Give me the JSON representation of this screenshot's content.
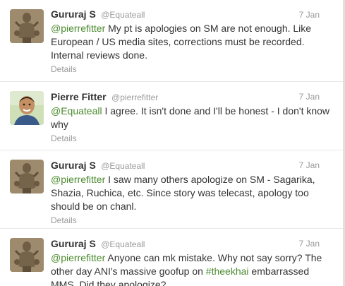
{
  "tweets": [
    {
      "fullname": "Gururaj S",
      "username": "@Equateall",
      "time": "7 Jan",
      "mention": "@pierrefitter",
      "text": " My pt is apologies on SM are not enough. Like European / US media sites, corrections must be recorded. Internal reviews done.",
      "details": "Details"
    },
    {
      "fullname": "Pierre Fitter",
      "username": "@pierrefitter",
      "time": "7 Jan",
      "mention": "@Equateall",
      "text": " I agree. It isn't done and I'll be honest - I don't know why",
      "details": "Details"
    },
    {
      "fullname": "Gururaj S",
      "username": "@Equateall",
      "time": "7 Jan",
      "mention": "@pierrefitter",
      "text": " I saw many others apologize on SM - Sagarika, Shazia, Ruchica, etc. Since story was telecast, apology too should be on chanl.",
      "details": "Details"
    },
    {
      "fullname": "Gururaj S",
      "username": "@Equateall",
      "time": "7 Jan",
      "mention": "@pierrefitter",
      "text": " Anyone can mk mistake. Why not say sorry? The other day ANI's massive goofup on ",
      "hashtag": "#theekhai",
      "text_after": " embarrassed MMS. Did they apologize?"
    }
  ],
  "colors": {
    "link": "#4a8a2e",
    "muted": "#999999",
    "text": "#333333",
    "divider": "#e8e8e8"
  },
  "icons": {
    "statue_avatar": "carved-statue-avatar",
    "person_avatar": "person-photo-avatar"
  }
}
